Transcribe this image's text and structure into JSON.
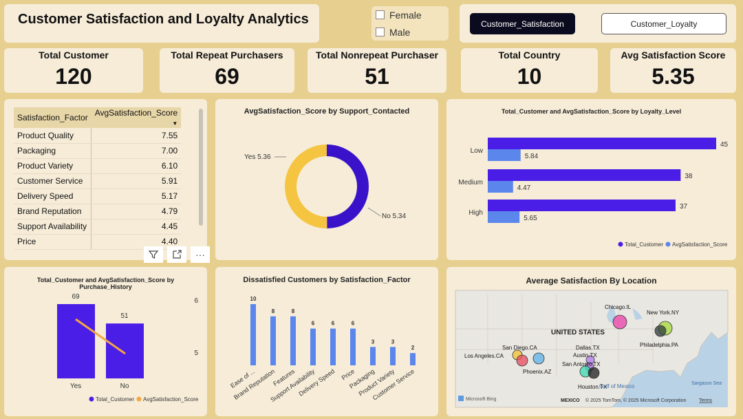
{
  "header": {
    "title": "Customer Satisfaction and Loyalty Analytics"
  },
  "gender_slicer": {
    "items": [
      "Female",
      "Male"
    ]
  },
  "nav_buttons": {
    "satisfaction": "Customer_Satisfaction",
    "loyalty": "Customer_Loyalty"
  },
  "kpis": [
    {
      "label": "Total Customer",
      "value": "120"
    },
    {
      "label": "Total Repeat Purchasers",
      "value": "69"
    },
    {
      "label": "Total Nonrepeat Purchaser",
      "value": "51"
    },
    {
      "label": "Total Country",
      "value": "10"
    },
    {
      "label": "Avg Satisfaction Score",
      "value": "5.35"
    }
  ],
  "factor_table": {
    "columns": [
      "Satisfaction_Factor",
      "AvgSatisfaction_Score"
    ],
    "rows": [
      [
        "Product Quality",
        "7.55"
      ],
      [
        "Packaging",
        "7.00"
      ],
      [
        "Product Variety",
        "6.10"
      ],
      [
        "Customer Service",
        "5.91"
      ],
      [
        "Delivery Speed",
        "5.17"
      ],
      [
        "Brand Reputation",
        "4.79"
      ],
      [
        "Support Availability",
        "4.45"
      ],
      [
        "Price",
        "4.40"
      ]
    ]
  },
  "colors": {
    "purple": "#4a1ee6",
    "blue": "#5b86ec",
    "orange": "#f4a742",
    "donut_purple": "#3a12c9",
    "donut_yellow": "#f5c441"
  },
  "chart_data": [
    {
      "type": "pie",
      "title": "AvgSatisfaction_Score by Support_Contacted",
      "categories": [
        "Yes",
        "No"
      ],
      "values": [
        5.36,
        5.34
      ],
      "labels": [
        "Yes 5.36",
        "No 5.34"
      ]
    },
    {
      "type": "bar",
      "title": "Total_Customer and AvgSatisfaction_Score by Loyalty_Level",
      "categories": [
        "Low",
        "Medium",
        "High"
      ],
      "series": [
        {
          "name": "Total_Customer",
          "values": [
            45,
            38,
            37
          ]
        },
        {
          "name": "AvgSatisfaction_Score",
          "values": [
            5.84,
            4.47,
            5.65
          ]
        }
      ],
      "orientation": "horizontal",
      "legend": "bottom-right"
    },
    {
      "type": "bar",
      "title": "Total_Customer and AvgSatisfaction_Score by Purchase_History",
      "categories": [
        "Yes",
        "No"
      ],
      "series": [
        {
          "name": "Total_Customer",
          "values": [
            69,
            51
          ]
        },
        {
          "name": "AvgSatisfaction_Score",
          "values": [
            5.36,
            5.33
          ]
        }
      ],
      "secondary_axis_ticks": [
        "6",
        "5"
      ],
      "legend": "bottom"
    },
    {
      "type": "bar",
      "title": "Dissatisfied Customers by Satisfaction_Factor",
      "categories": [
        "Ease of ...",
        "Brand Reputation",
        "Features",
        "Support Availability",
        "Delivery Speed",
        "Price",
        "Packaging",
        "Product Variety",
        "Customer Service"
      ],
      "values": [
        10,
        8,
        8,
        6,
        6,
        6,
        3,
        3,
        2
      ]
    }
  ],
  "map": {
    "title": "Average Satisfaction By Location",
    "country_label": "UNITED STATES",
    "mexico_label": "MEXICO",
    "gulf_label": "Gulf of Mexico",
    "sea_label": "Sargasso Sea",
    "cities": [
      {
        "name": "Chicago.IL",
        "color": "#e83ea8"
      },
      {
        "name": "New York.NY",
        "color": "#a6d93a"
      },
      {
        "name": "Philadelphia.PA",
        "color": "#2e3b3b"
      },
      {
        "name": "San Diego.CA",
        "color": "#f2c12e"
      },
      {
        "name": "Los Angeles.CA",
        "color": "#e84a5f"
      },
      {
        "name": "Phoenix.AZ",
        "color": "#5bb0e8"
      },
      {
        "name": "Dallas.TX",
        "color": "#b27ae8"
      },
      {
        "name": "Austin.TX",
        "color": "#b27ae8"
      },
      {
        "name": "San Antonio.TX",
        "color": "#3ad9b0"
      },
      {
        "name": "Houston.TX",
        "color": "#1e1e1e"
      }
    ],
    "attribution": "© 2025 TomTom, © 2025 Microsoft Corporation",
    "terms": "Terms",
    "bing": "Microsoft Bing"
  }
}
